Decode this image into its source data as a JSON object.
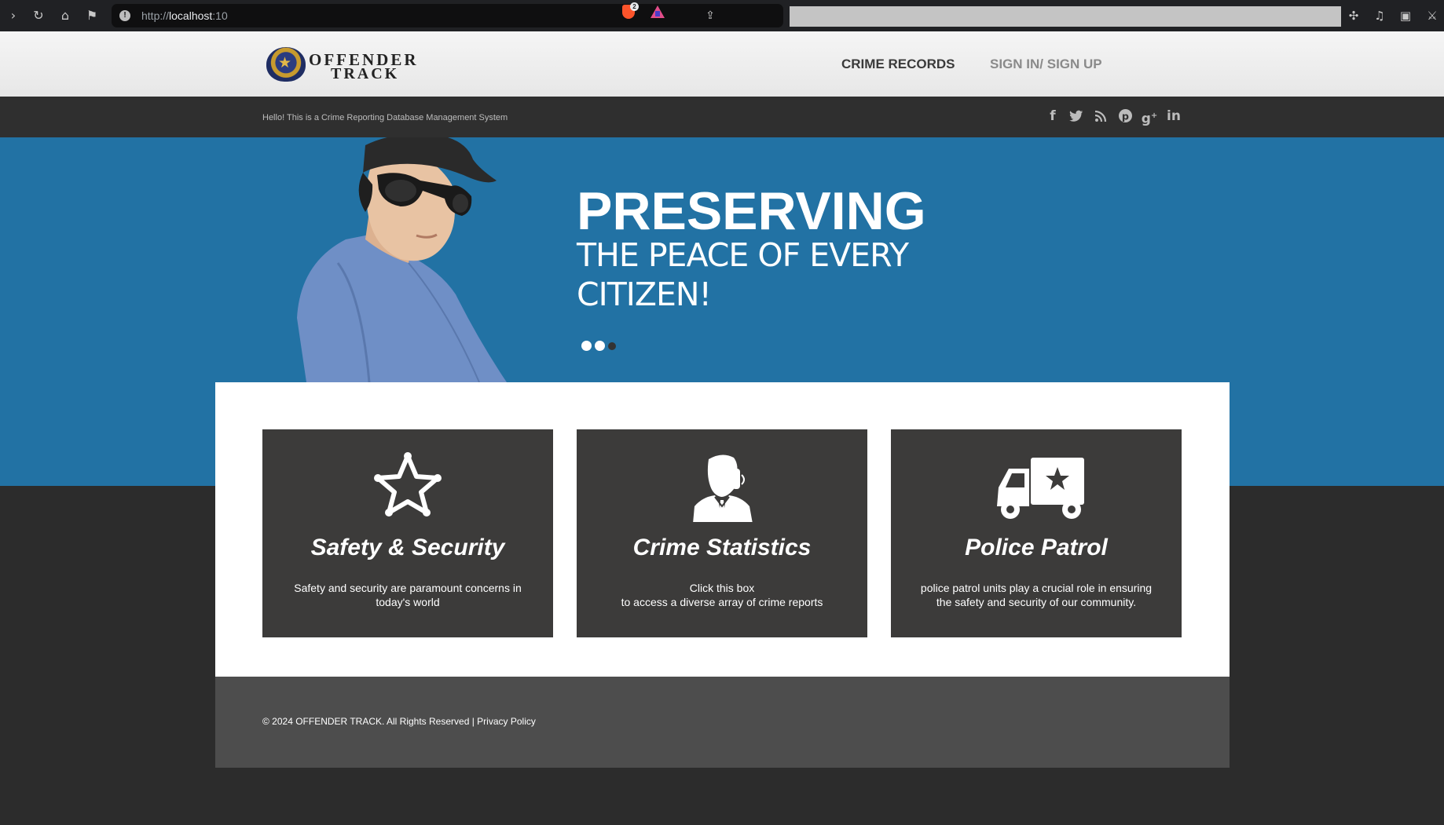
{
  "browser": {
    "url_scheme": "http://",
    "url_host": "localhost",
    "url_rest": ":10",
    "shield_count": "2"
  },
  "site": {
    "logo_line1": "OFFENDER",
    "logo_line2": "TRACK",
    "nav": {
      "crime_records": "CRIME RECORDS",
      "signin": "SIGN IN/ SIGN UP"
    },
    "tagline": "Hello! This is a Crime Reporting Database Management System",
    "social_icons": [
      "facebook-icon",
      "twitter-icon",
      "rss-icon",
      "pinterest-icon",
      "google-plus-icon",
      "linkedin-icon"
    ]
  },
  "hero": {
    "title": "PRESERVING",
    "subtitle": "THE PEACE OF EVERY CITIZEN!",
    "slides_total": 3,
    "active_slide": 3
  },
  "cards": [
    {
      "icon": "sheriff-star-icon",
      "title": "Safety & Security",
      "text": "Safety and security are paramount concerns in today's world"
    },
    {
      "icon": "officer-phone-icon",
      "title": "Crime Statistics",
      "text_line1": "Click this box",
      "text_line2": "to access a diverse array of crime reports"
    },
    {
      "icon": "police-van-icon",
      "title": "Police Patrol",
      "text": "police patrol units play a crucial role in ensuring the safety and security of our community."
    }
  ],
  "footer": {
    "copyright": "© 2024 OFFENDER TRACK. All Rights Reserved | ",
    "privacy": "Privacy Policy"
  },
  "colors": {
    "hero_blue": "#2272a4",
    "card_dark": "#3c3b3a",
    "footer_grey": "#4d4d4d",
    "page_dark": "#2c2c2c"
  }
}
